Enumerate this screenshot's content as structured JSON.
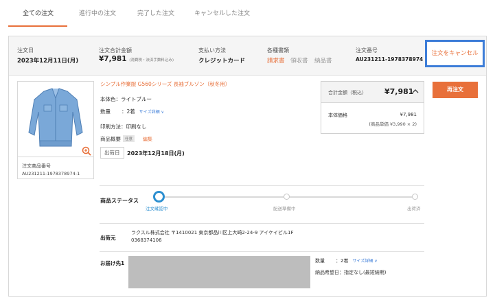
{
  "tabs": [
    {
      "label": "全ての注文"
    },
    {
      "label": "進行中の注文"
    },
    {
      "label": "完了した注文"
    },
    {
      "label": "キャンセルした注文"
    }
  ],
  "summary": {
    "order_date_label": "注文日",
    "order_date": "2023年12月11日(月)",
    "total_label": "注文合計金額",
    "total": "¥7,981",
    "total_note": "(消費税・決済手数料込み)",
    "payment_label": "支払い方法",
    "payment": "クレジットカード",
    "docs_label": "各種書類",
    "docs": [
      "請求書",
      "領収書",
      "納品書"
    ],
    "order_no_label": "注文番号",
    "order_no": "AU231211-1978378974",
    "cancel_button": "注文をキャンセル"
  },
  "product": {
    "code_label": "注文商品番号",
    "code": "AU231211-1978378974-1",
    "title": "シンプル作業服 G560シリーズ 長袖ブルゾン（秋冬用）",
    "color": "本体色：ライトブルー",
    "qty_label": "数量",
    "qty": "：2着",
    "size_link": "サイズ詳細 ∨",
    "print": "印刷方法：印刷なし",
    "memo_label": "商品概要",
    "memo_badge": "任意",
    "memo_edit": "編集",
    "ship_label": "出荷日",
    "ship_date": "2023年12月18日(月)"
  },
  "price": {
    "total_label": "合計金額（税込）",
    "total": "¥7,981",
    "body_label": "本体価格",
    "body_price": "¥7,981",
    "unit_note": "(商品単価 ¥3,990 × 2)"
  },
  "reorder_button": "再注文",
  "status": {
    "label": "商品ステータス",
    "steps": [
      "注文確認中",
      "配送準備中",
      "出荷済"
    ],
    "current_step": 1
  },
  "sender": {
    "label": "出荷元",
    "line1": "ラクスル株式会社 〒1410021 東京都品川区上大崎2-24-9 アイケイビル1F",
    "line2": "0368374106"
  },
  "destination": {
    "label": "お届け先1",
    "qty_label": "数量",
    "qty": "：2着",
    "size_link": "サイズ詳細 ∨",
    "delivery": "納品希望日：指定なし(最短納期)"
  },
  "colors": {
    "accent": "#e8703a",
    "link": "#3d7dd8",
    "status": "#2c8fd0"
  },
  "icons": [
    "zoom-in-icon",
    "chevron-up-icon",
    "chevron-down-icon"
  ]
}
